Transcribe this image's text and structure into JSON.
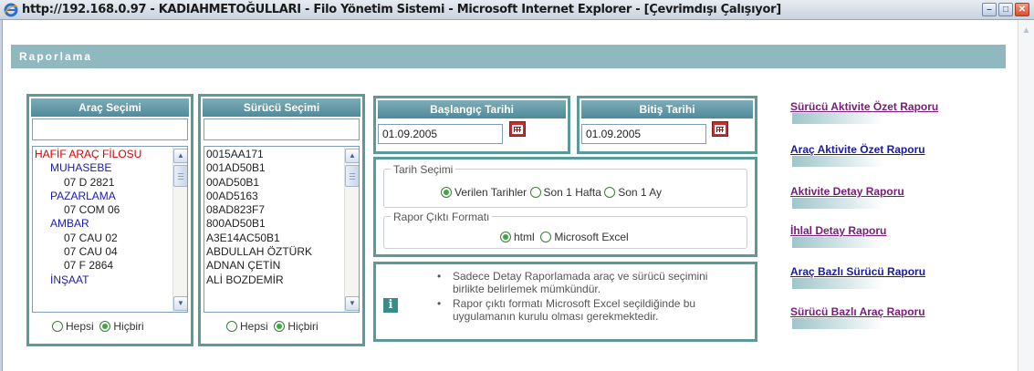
{
  "window": {
    "title": "http://192.168.0.97 - KADIAHMETOĞULLARI - Filo Yönetim Sistemi - Microsoft Internet Explorer - [Çevrimdışı Çalışıyor]",
    "minimize": "–",
    "maximize": "□",
    "close": "✕"
  },
  "section_title": "Raporlama",
  "arac_secimi": {
    "header": "Araç Seçimi",
    "search_value": "",
    "items": [
      {
        "label": "HAFİF ARAÇ FİLOSU",
        "level": 0
      },
      {
        "label": "MUHASEBE",
        "level": 1
      },
      {
        "label": "07 D 2821",
        "level": 2
      },
      {
        "label": "PAZARLAMA",
        "level": 1
      },
      {
        "label": "07 COM 06",
        "level": 2
      },
      {
        "label": "AMBAR",
        "level": 1
      },
      {
        "label": "07 CAU 02",
        "level": 2
      },
      {
        "label": "07 CAU 04",
        "level": 2
      },
      {
        "label": "07 F 2864",
        "level": 2
      },
      {
        "label": "İNŞAAT",
        "level": 1
      }
    ],
    "radio_all": "Hepsi",
    "radio_none": "Hiçbiri",
    "selected": "none"
  },
  "surucu_secimi": {
    "header": "Sürücü Seçimi",
    "search_value": "",
    "items": [
      "0015AA171",
      "001AD50B1",
      "00AD50B1",
      "00AD5163",
      "08AD823F7",
      "800AD50B1",
      "A3E14AC50B1",
      "ABDULLAH ÖZTÜRK",
      "ADNAN ÇETİN",
      "ALİ BOZDEMİR"
    ],
    "radio_all": "Hepsi",
    "radio_none": "Hiçbiri",
    "selected": "none"
  },
  "baslangic": {
    "header": "Başlangıç Tarihi",
    "value": "01.09.2005"
  },
  "bitis": {
    "header": "Bitiş Tarihi",
    "value": "01.09.2005"
  },
  "tarih_secimi": {
    "legend": "Tarih Seçimi",
    "options": [
      "Verilen Tarihler",
      "Son 1 Hafta",
      "Son 1 Ay"
    ],
    "selected": "Verilen Tarihler"
  },
  "rapor_format": {
    "legend": "Rapor Çıktı Formatı",
    "options": [
      "html",
      "Microsoft Excel"
    ],
    "selected": "html"
  },
  "info": {
    "icon": "i",
    "notes": [
      [
        "Sadece Detay Raporlamada araç ve sürücü seçimini",
        "birlikte belirlemek mümkündür."
      ],
      [
        "Rapor çıktı formatı Microsoft Excel seçildiğinde bu",
        "uygulamanın kurulu olması gerekmektedir."
      ]
    ]
  },
  "reports": [
    {
      "label": "Sürücü Aktivite Özet Raporu",
      "color": "#7a1a7a"
    },
    {
      "label": "Araç Aktivite Özet Raporu",
      "color": "#1a1aa0"
    },
    {
      "label": "Aktivite Detay Raporu",
      "color": "#7a1a7a"
    },
    {
      "label": "İhlal Detay Raporu",
      "color": "#7a1a7a"
    },
    {
      "label": "Araç Bazlı Sürücü Raporu",
      "color": "#1a1aa0"
    },
    {
      "label": "Sürücü Bazlı Araç Raporu",
      "color": "#7a1a7a"
    }
  ],
  "colors": {
    "panel_border": "#5a9a9a",
    "section_bar": "#8fb8bf",
    "vehicle_group": "#d40000",
    "vehicle_dept": "#1a1ab0"
  }
}
